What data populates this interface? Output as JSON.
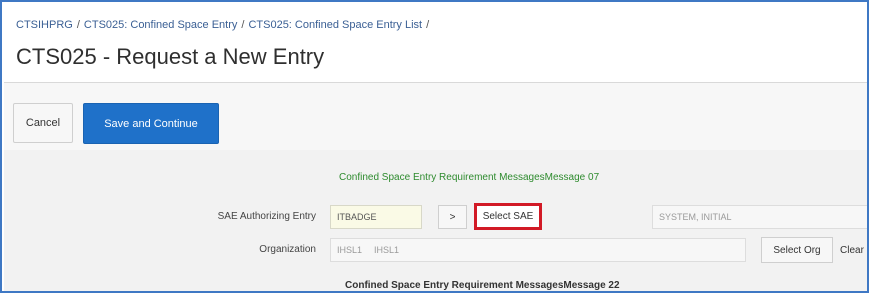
{
  "breadcrumb": {
    "items": [
      "CTSIHPRG",
      "CTS025: Confined Space Entry",
      "CTS025: Confined Space Entry List"
    ],
    "separator": "/"
  },
  "page": {
    "title": "CTS025 - Request a New Entry"
  },
  "toolbar": {
    "cancel_label": "Cancel",
    "save_label": "Save and Continue"
  },
  "form": {
    "message_top": "Confined Space Entry Requirement MessagesMessage 07",
    "sae": {
      "label": "SAE Authorizing Entry",
      "value": "ITBADGE",
      "arrow_label": ">",
      "select_label": "Select SAE",
      "name_value": "SYSTEM, INITIAL"
    },
    "organization": {
      "label": "Organization",
      "code_value": "IHSL1",
      "name_value": "IHSL1",
      "select_label": "Select Org",
      "clear_label": "Clear"
    },
    "message_bottom": "Confined Space Entry Requirement MessagesMessage 22"
  },
  "colors": {
    "accent": "#1f71c9",
    "highlight": "#d21a26",
    "message_green": "#2e8b2e",
    "frame_border": "#3f78c4"
  }
}
